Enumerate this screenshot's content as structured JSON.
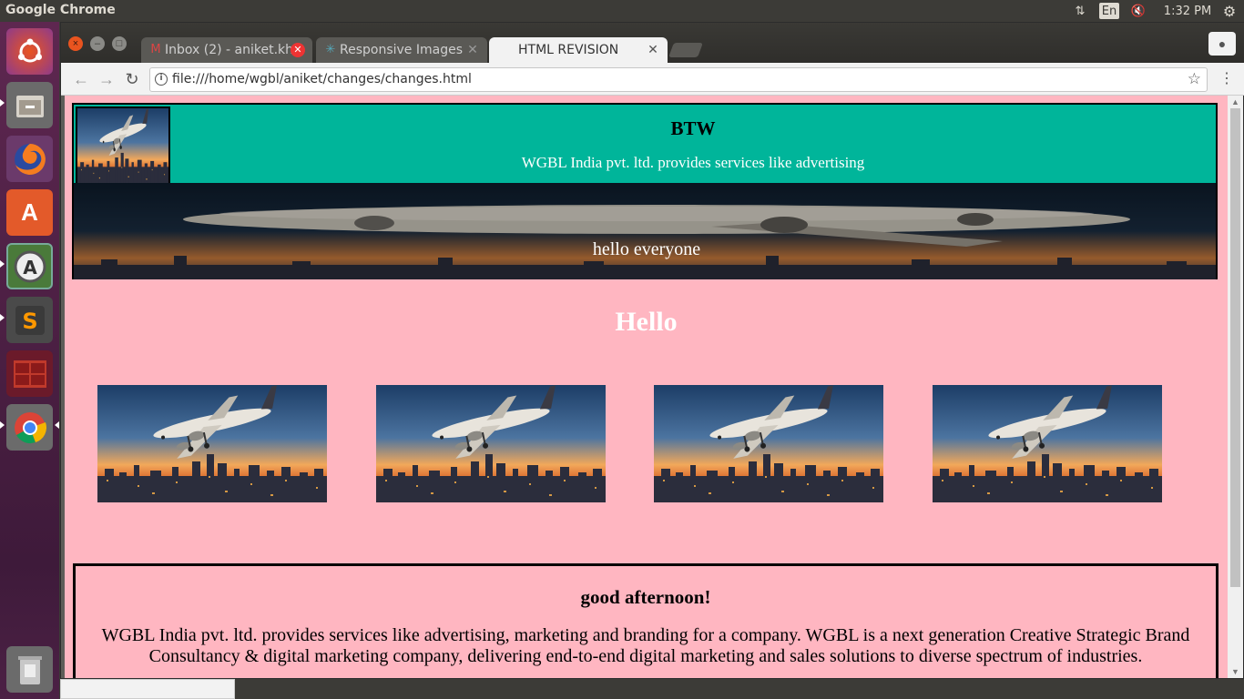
{
  "topbar": {
    "app_name": "Google Chrome",
    "keyboard": "En",
    "time": "1:32 PM",
    "icons": [
      "network-icon",
      "keyboard-indicator",
      "volume-muted-icon",
      "power-settings-icon"
    ]
  },
  "launcher": {
    "items": [
      "ubuntu-dash",
      "files",
      "firefox",
      "software-center",
      "software-updater",
      "sublime-text",
      "terminal",
      "chrome",
      "trash"
    ]
  },
  "browser": {
    "tabs": [
      {
        "label": "Inbox (2) - aniket.kh",
        "icon": "gmail-icon",
        "state": "inactive",
        "close": "error"
      },
      {
        "label": "Responsive Images",
        "icon": "site-icon",
        "state": "inactive",
        "close": "normal"
      },
      {
        "label": "HTML REVISION",
        "icon": "",
        "state": "active",
        "close": "normal"
      }
    ],
    "url": "file:///home/wgbl/aniket/changes/changes.html"
  },
  "page": {
    "header": {
      "brand": "BTW",
      "tagline": "WGBL India pvt. ltd. provides services like advertising"
    },
    "banner_text": "hello everyone",
    "heading": "Hello",
    "gallery_count": 4,
    "info": {
      "greeting": "good afternoon!",
      "about": "WGBL India pvt. ltd. provides services like advertising, marketing and branding for a company. WGBL is a next generation Creative Strategic Brand Consultancy & digital marketing company, delivering end-to-end digital marketing and sales solutions to diverse spectrum of industries."
    }
  },
  "colors": {
    "page_bg": "#ffb6c1",
    "header_bg": "#00b59a",
    "launcher": "#5e2750"
  }
}
